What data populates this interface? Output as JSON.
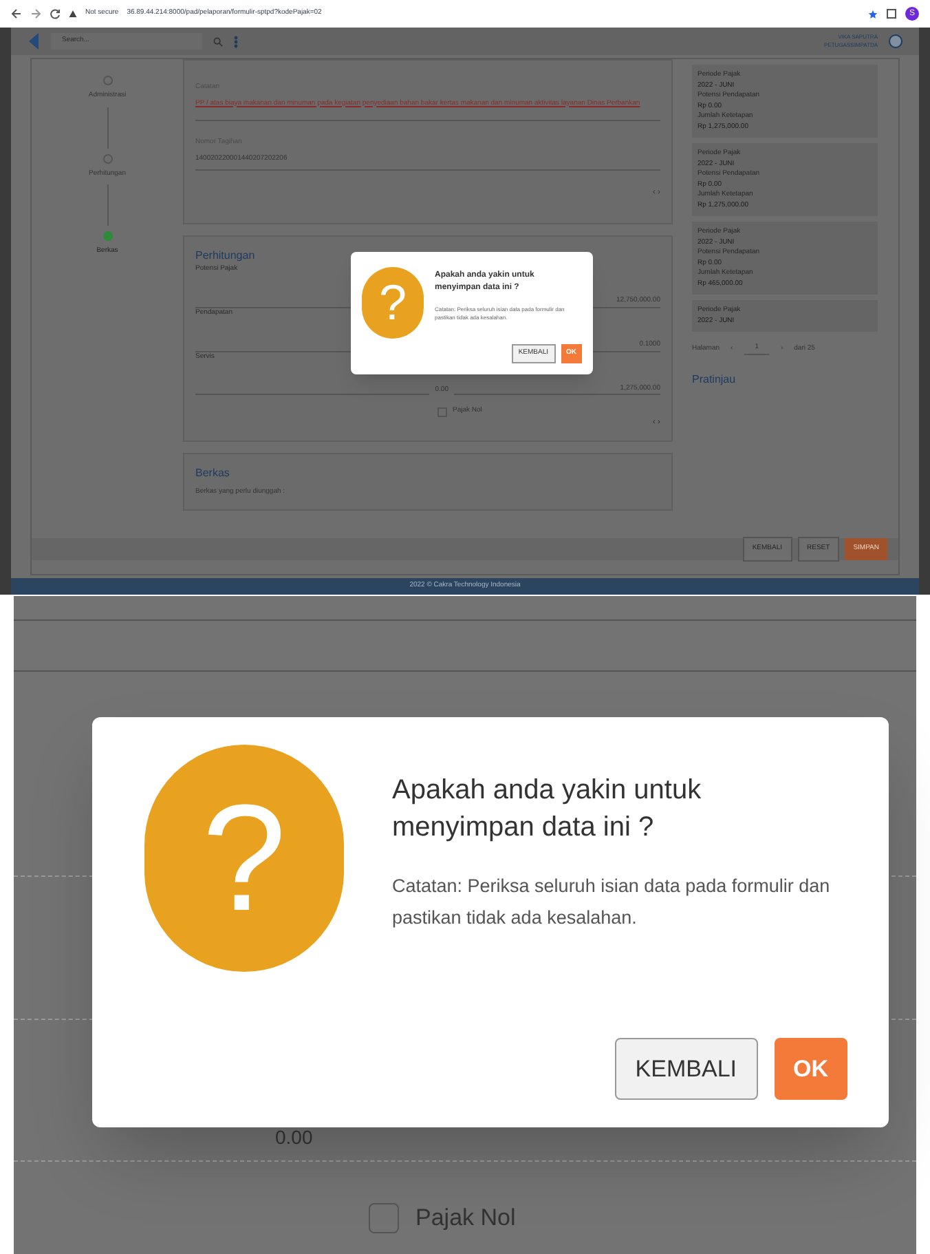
{
  "browser": {
    "security": "Not secure",
    "url": "36.89.44.214:8000/pad/pelaporan/formulir-sptpd?kodePajak=02",
    "profile_initial": "S"
  },
  "app": {
    "search": {
      "placeholder": "Search..."
    },
    "user": {
      "name": "VIKA SAPUTRA",
      "id": "PETUGASSIMPATDA"
    },
    "steps": [
      {
        "label": "Administrasi",
        "selected": false
      },
      {
        "label": "Perhitungan",
        "selected": false
      },
      {
        "label": "Berkas",
        "selected": true
      }
    ],
    "detail": {
      "note_label": "Catatan",
      "note": "PP / atas biaya makanan dan minuman pada kegiatan penyediaan bahan bakar kertas makanan dan minuman aktivitas layanan Dinas Perbankan",
      "bill_label": "Nomor Tagihan",
      "bill": "140020220001440207202206",
      "pager": "‹ ›"
    },
    "calc": {
      "title": "Perhitungan",
      "fields": [
        {
          "label": "Potensi Pajak",
          "value": "12,750,000.00"
        },
        {
          "label": "Pendapatan",
          "value": "0.1000"
        },
        {
          "label": "Servis",
          "value": "1,275,000.00",
          "prefix": "0.00"
        }
      ],
      "zero_tax": {
        "label": "Pajak Nol",
        "checked": false
      },
      "pager": "‹ ›"
    },
    "files": {
      "title": "Berkas",
      "hint": "Berkas yang perlu diunggah :"
    },
    "history": [
      {
        "period_label": "Periode Pajak",
        "period": "2022 - JUNI",
        "income_label": "Potensi Pendapatan",
        "income": "Rp 0.00",
        "amount_label": "Jumlah Ketetapan",
        "amount": "Rp 1,275,000.00"
      },
      {
        "period_label": "Periode Pajak",
        "period": "2022 - JUNI",
        "income_label": "Potensi Pendapatan",
        "income": "Rp 0.00",
        "amount_label": "Jumlah Ketetapan",
        "amount": "Rp 1,275,000.00"
      },
      {
        "period_label": "Periode Pajak",
        "period": "2022 - JUNI",
        "income_label": "Potensi Pendapatan",
        "income": "Rp 0.00",
        "amount_label": "Jumlah Ketetapan",
        "amount": "Rp 465,000.00"
      },
      {
        "period_label": "Periode Pajak",
        "period": "2022 - JUNI"
      }
    ],
    "pagination": {
      "label": "Halaman",
      "prev": "‹",
      "page": "1",
      "next": "›",
      "total": "dari 25"
    },
    "preview_title": "Pratinjau",
    "actions": [
      {
        "label": "KEMBALI",
        "kind": "plain"
      },
      {
        "label": "RESET",
        "kind": "plain"
      },
      {
        "label": "SIMPAN",
        "kind": "primary"
      }
    ],
    "footer": "2022 © Cakra Technology Indonesia",
    "dialog": {
      "icon": "?",
      "title": "Apakah anda yakin untuk menyimpan data ini ?",
      "note": "Catatan: Periksa seluruh isian data pada formulir dan pastikan tidak ada kesalahan.",
      "buttons": [
        {
          "label": "KEMBALI",
          "kind": "plain"
        },
        {
          "label": "OK",
          "kind": "primary"
        }
      ]
    }
  },
  "zoomed": {
    "dialog": {
      "icon": "?",
      "title": "Apakah anda yakin untuk menyimpan data ini ?",
      "note": "Catatan: Periksa seluruh isian data pada formulir dan pastikan tidak ada kesalahan.",
      "buttons": [
        {
          "label": "KEMBALI",
          "kind": "plain"
        },
        {
          "label": "OK",
          "kind": "primary"
        }
      ]
    },
    "amount": "0.00",
    "zero_tax": {
      "label": "Pajak Nol",
      "checked": false
    }
  }
}
